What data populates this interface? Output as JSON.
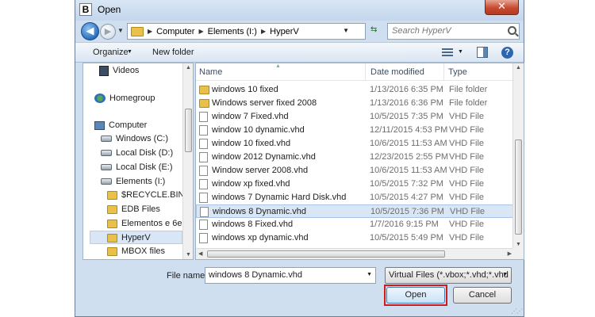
{
  "window": {
    "title": "Open",
    "app_icon_letter": "B",
    "close_glyph": "✕"
  },
  "nav": {
    "back_glyph": "◀",
    "forward_glyph": "▶",
    "breadcrumbs": [
      "Computer",
      "Elements (I:)",
      "HyperV"
    ],
    "search_placeholder": "Search HyperV"
  },
  "toolbar": {
    "organize_label": "Organize",
    "new_folder_label": "New folder"
  },
  "sidebar": {
    "items": [
      {
        "label": "Videos",
        "icon": "video-icon"
      },
      {
        "label": "Homegroup",
        "icon": "homegroup-icon"
      },
      {
        "label": "Computer",
        "icon": "computer-icon"
      },
      {
        "label": "Windows (C:)",
        "icon": "drive-icon"
      },
      {
        "label": "Local Disk (D:)",
        "icon": "drive-icon"
      },
      {
        "label": "Local Disk (E:)",
        "icon": "drive-icon"
      },
      {
        "label": "Elements (I:)",
        "icon": "drive-icon"
      },
      {
        "label": "$RECYCLE.BIN",
        "icon": "folder-icon"
      },
      {
        "label": "EDB Files",
        "icon": "folder-icon"
      },
      {
        "label": "Elementos e 6e",
        "icon": "folder-icon"
      },
      {
        "label": "HyperV",
        "icon": "folder-icon",
        "selected": true
      },
      {
        "label": "MBOX files",
        "icon": "folder-icon"
      }
    ]
  },
  "file_list": {
    "columns": [
      "Name",
      "Date modified",
      "Type"
    ],
    "rows": [
      {
        "name": "windows 10 fixed",
        "date": "1/13/2016 6:35 PM",
        "type": "File folder",
        "kind": "folder"
      },
      {
        "name": "Windows server fixed 2008",
        "date": "1/13/2016 6:36 PM",
        "type": "File folder",
        "kind": "folder"
      },
      {
        "name": "window 7 Fixed.vhd",
        "date": "10/5/2015 7:35 PM",
        "type": "VHD File",
        "kind": "file"
      },
      {
        "name": "window 10 dynamic.vhd",
        "date": "12/11/2015 4:53 PM",
        "type": "VHD File",
        "kind": "file"
      },
      {
        "name": "window 10 fixed.vhd",
        "date": "10/6/2015 11:53 AM",
        "type": "VHD File",
        "kind": "file"
      },
      {
        "name": "window 2012 Dynamic.vhd",
        "date": "12/23/2015 2:55 PM",
        "type": "VHD File",
        "kind": "file"
      },
      {
        "name": "Window server 2008.vhd",
        "date": "10/6/2015 11:53 AM",
        "type": "VHD File",
        "kind": "file"
      },
      {
        "name": "window xp fixed.vhd",
        "date": "10/5/2015 7:32 PM",
        "type": "VHD File",
        "kind": "file"
      },
      {
        "name": "windows 7 Dynamic Hard Disk.vhd",
        "date": "10/5/2015 4:27 PM",
        "type": "VHD File",
        "kind": "file"
      },
      {
        "name": "windows 8 Dynamic.vhd",
        "date": "10/5/2015 7:36 PM",
        "type": "VHD File",
        "kind": "file",
        "selected": true
      },
      {
        "name": "windows 8 Fixed.vhd",
        "date": "1/7/2016 9:15 PM",
        "type": "VHD File",
        "kind": "file"
      },
      {
        "name": "windows xp dynamic.vhd",
        "date": "10/5/2015 5:49 PM",
        "type": "VHD File",
        "kind": "file"
      }
    ]
  },
  "bottom": {
    "file_name_label": "File name:",
    "file_name_value": "windows 8 Dynamic.vhd",
    "file_type_value": "Virtual Files (*.vbox;*.vhd;*.vhd",
    "open_label": "Open",
    "cancel_label": "Cancel"
  },
  "colors": {
    "highlight_border": "#d11a1a",
    "window_frame": "#cfdff0",
    "selection": "#d9e6f5"
  }
}
